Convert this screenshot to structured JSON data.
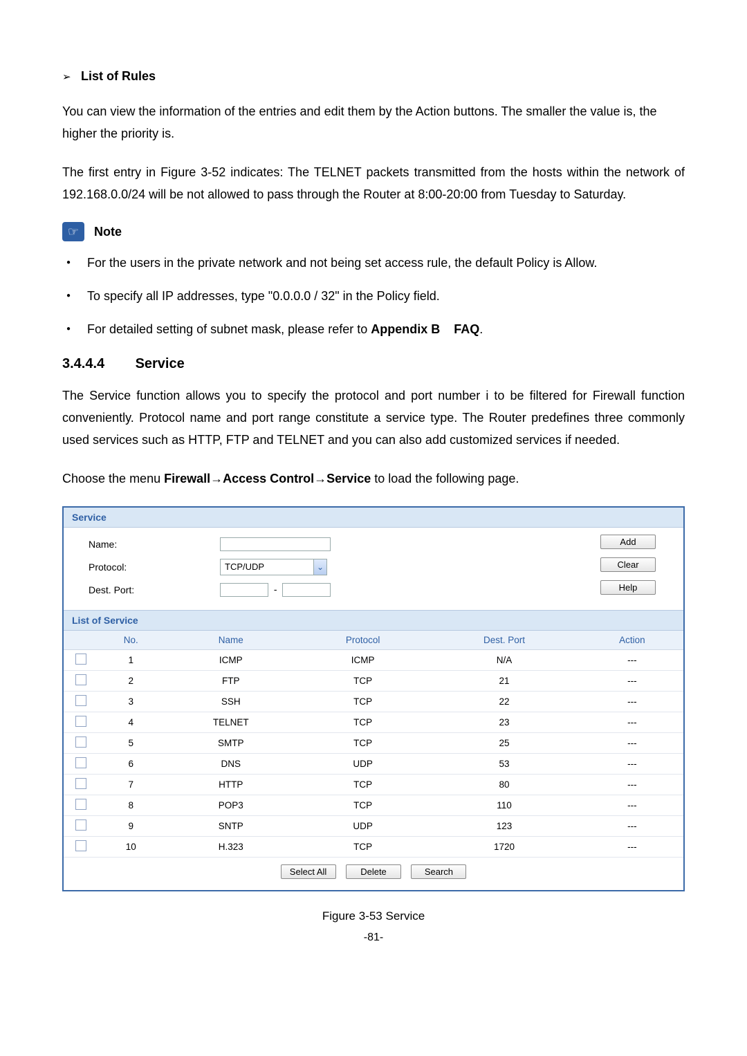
{
  "rules_heading": "List of Rules",
  "para1": "You can view the information of the entries and edit them by the Action buttons. The smaller the value is, the higher the priority is.",
  "para2": "The first entry in Figure 3-52 indicates: The TELNET packets transmitted from the hosts within the network of 192.168.0.0/24 will be not allowed to pass through the Router at 8:00-20:00 from Tuesday to Saturday.",
  "note_label": "Note",
  "bullets": {
    "b1": "For the users in the private network and not being set access rule, the default Policy is Allow.",
    "b2": "To specify all IP addresses, type \"0.0.0.0 / 32\" in the Policy field.",
    "b3_prefix": "For detailed setting of subnet mask, please refer to ",
    "b3_bold1": "Appendix B",
    "b3_mid": "    ",
    "b3_bold2": "FAQ",
    "b3_suffix": "."
  },
  "sec_num": "3.4.4.4",
  "sec_title": "Service",
  "para3": "The Service function allows you to specify the protocol and port number i to be filtered for Firewall function conveniently. Protocol name and port range constitute a service type. The Router predefines three commonly used services such as HTTP, FTP and TELNET and you can also add customized services if needed.",
  "para4_prefix": "Choose the menu ",
  "para4_bold": "Firewall→Access Control→Service",
  "para4_suffix": " to load the following page.",
  "panel": {
    "title": "Service",
    "labels": {
      "name": "Name:",
      "protocol": "Protocol:",
      "port": "Dest. Port:"
    },
    "protocol_value": "TCP/UDP",
    "port_sep": "-",
    "buttons": {
      "add": "Add",
      "clear": "Clear",
      "help": "Help"
    },
    "list_title": "List of Service",
    "columns": {
      "no": "No.",
      "name": "Name",
      "protocol": "Protocol",
      "port": "Dest. Port",
      "action": "Action"
    },
    "rows": [
      {
        "no": "1",
        "name": "ICMP",
        "protocol": "ICMP",
        "port": "N/A",
        "action": "---"
      },
      {
        "no": "2",
        "name": "FTP",
        "protocol": "TCP",
        "port": "21",
        "action": "---"
      },
      {
        "no": "3",
        "name": "SSH",
        "protocol": "TCP",
        "port": "22",
        "action": "---"
      },
      {
        "no": "4",
        "name": "TELNET",
        "protocol": "TCP",
        "port": "23",
        "action": "---"
      },
      {
        "no": "5",
        "name": "SMTP",
        "protocol": "TCP",
        "port": "25",
        "action": "---"
      },
      {
        "no": "6",
        "name": "DNS",
        "protocol": "UDP",
        "port": "53",
        "action": "---"
      },
      {
        "no": "7",
        "name": "HTTP",
        "protocol": "TCP",
        "port": "80",
        "action": "---"
      },
      {
        "no": "8",
        "name": "POP3",
        "protocol": "TCP",
        "port": "110",
        "action": "---"
      },
      {
        "no": "9",
        "name": "SNTP",
        "protocol": "UDP",
        "port": "123",
        "action": "---"
      },
      {
        "no": "10",
        "name": "H.323",
        "protocol": "TCP",
        "port": "1720",
        "action": "---"
      }
    ],
    "footer_buttons": {
      "select_all": "Select All",
      "delete": "Delete",
      "search": "Search"
    }
  },
  "figure_caption": "Figure 3-53 Service",
  "page_number": "-81-"
}
